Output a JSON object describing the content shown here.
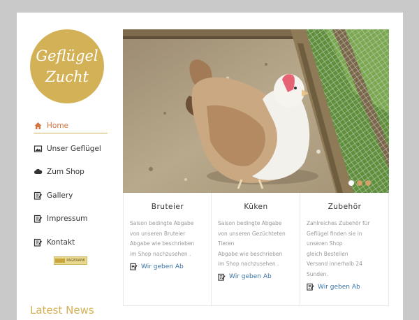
{
  "logo": {
    "line1": "Geflügel",
    "line2": "Zucht"
  },
  "nav": [
    {
      "label": "Home",
      "icon": "home-icon",
      "active": true
    },
    {
      "label": "Unser Geflügel",
      "icon": "image-icon"
    },
    {
      "label": "Zum Shop",
      "icon": "cloud-icon"
    },
    {
      "label": " Gallery",
      "icon": "edit-icon"
    },
    {
      "label": "Impressum",
      "icon": "edit-icon"
    },
    {
      "label": "Kontakt",
      "icon": "edit-icon"
    }
  ],
  "pagerank": {
    "label": "PAGERANK"
  },
  "latest_news": "Latest News",
  "hero": {
    "slides": 3,
    "active_slide": 1
  },
  "cards": [
    {
      "title": "Bruteier",
      "lines": [
        "Saison bedingte Abgabe",
        "von unseren Bruteier",
        "Abgabe wie beschrieben",
        "im Shop nachzusehen ."
      ],
      "link": "Wir geben Ab"
    },
    {
      "title": "Küken",
      "lines": [
        "Saison bedingte Abgabe",
        "von unseren Gezüchteten",
        "Tieren",
        "Abgabe wie beschrieben",
        "im Shop nachzusehen ."
      ],
      "link": "Wir geben Ab"
    },
    {
      "title": "Zubehör",
      "lines": [
        "Zahlreiches Zubehör für",
        "Geflügel finden sie in",
        "unseren Shop",
        "gleich Bestellen",
        "Versand innerhalb 24",
        "Sunden."
      ],
      "link": "Wir geben Ab"
    }
  ],
  "colors": {
    "accent": "#d3b257",
    "active_nav": "#d2743f",
    "link": "#3a73a8"
  }
}
